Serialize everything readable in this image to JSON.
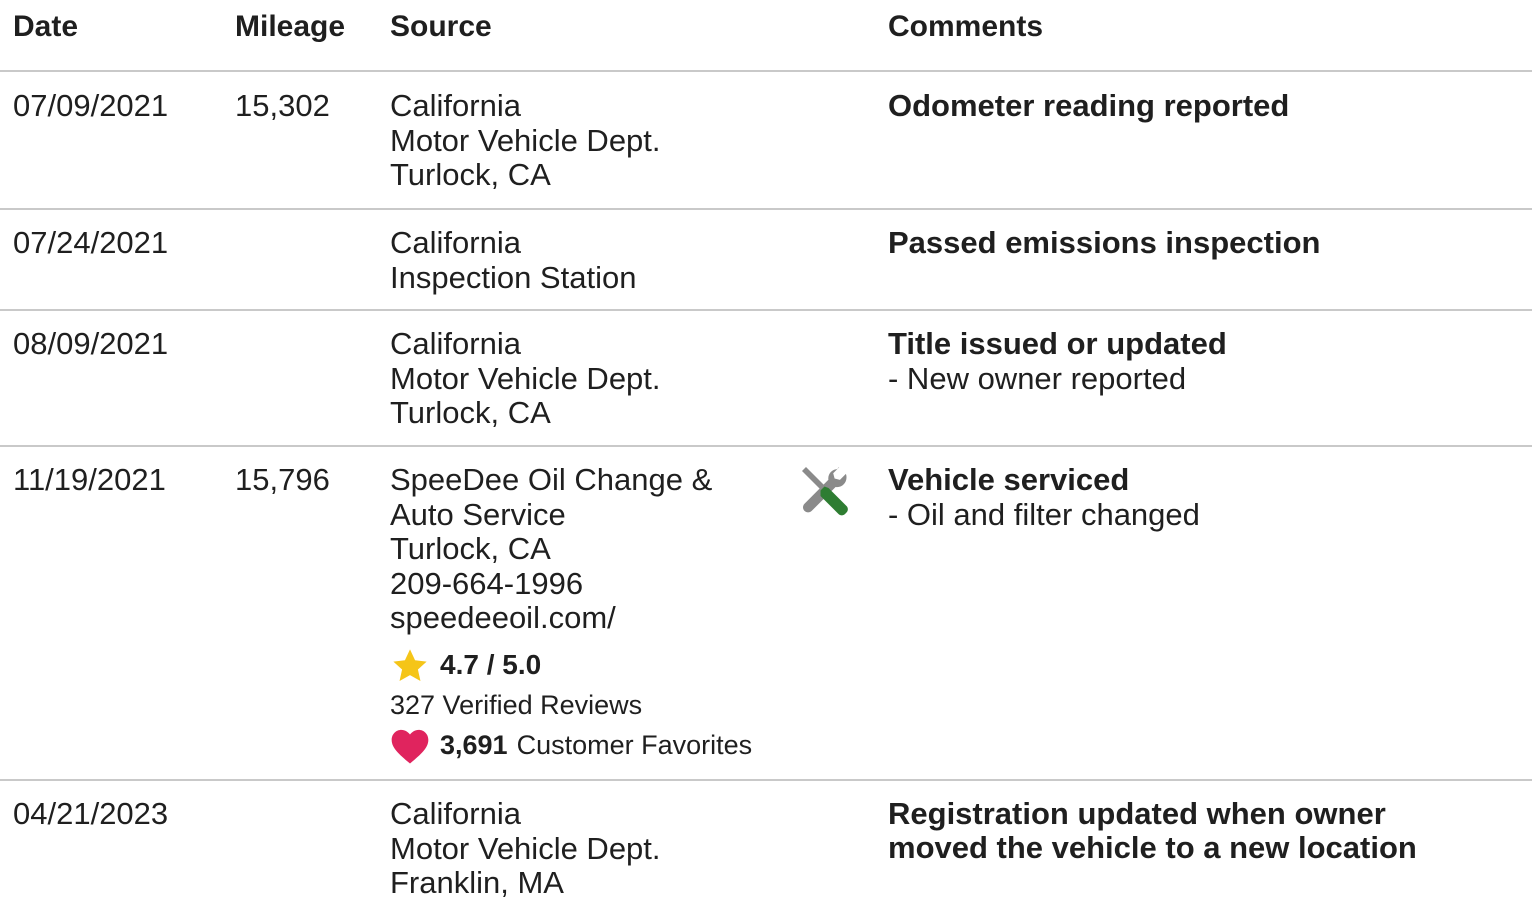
{
  "header": {
    "date": "Date",
    "mileage": "Mileage",
    "source": "Source",
    "comments": "Comments"
  },
  "rows": [
    {
      "date": "07/09/2021",
      "mileage": "15,302",
      "source": [
        "California",
        "Motor Vehicle Dept.",
        "Turlock, CA"
      ],
      "comment_title": "Odometer reading reported",
      "comment_detail": ""
    },
    {
      "date": "07/24/2021",
      "mileage": "",
      "source": [
        "California",
        "Inspection Station"
      ],
      "comment_title": "Passed emissions inspection",
      "comment_detail": ""
    },
    {
      "date": "08/09/2021",
      "mileage": "",
      "source": [
        "California",
        "Motor Vehicle Dept.",
        "Turlock, CA"
      ],
      "comment_title": "Title issued or updated",
      "comment_detail": "- New owner reported"
    },
    {
      "date": "11/19/2021",
      "mileage": "15,796",
      "source": [
        "SpeeDee Oil Change & Auto Service",
        "Turlock, CA",
        "209-664-1996",
        "speedeeoil.com/"
      ],
      "rating": "4.7 / 5.0",
      "reviews": "327 Verified Reviews",
      "favorites_count": "3,691",
      "favorites_label": "Customer Favorites",
      "icon": "service-tools-icon",
      "comment_title": "Vehicle serviced",
      "comment_detail": "- Oil and filter changed"
    },
    {
      "date": "04/21/2023",
      "mileage": "",
      "source": [
        "California",
        "Motor Vehicle Dept.",
        "Franklin, MA"
      ],
      "comment_title": "Registration updated when owner moved the vehicle to a new location",
      "comment_detail": ""
    }
  ],
  "colors": {
    "star": "#f5c518",
    "heart": "#e0245e",
    "wrench": "#8a8a8a",
    "screwdriver": "#2e7d32",
    "divider": "#c9c9c9"
  }
}
